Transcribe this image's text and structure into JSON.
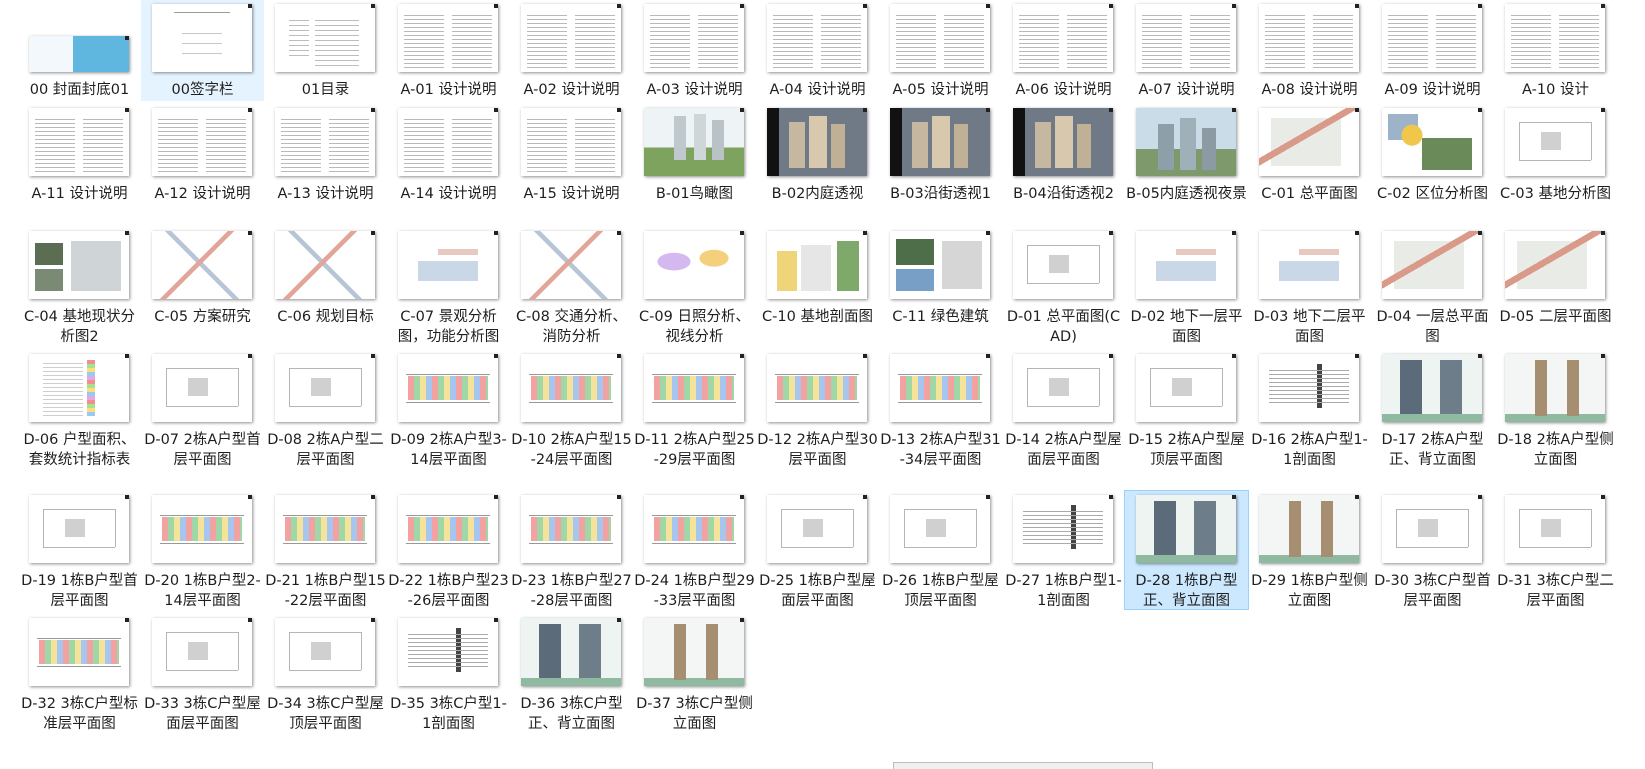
{
  "files": [
    {
      "label": "00  封面封底01",
      "thumb": "cover"
    },
    {
      "label": "00签字栏",
      "thumb": "sign",
      "state": "highlight"
    },
    {
      "label": "01目录",
      "thumb": "toc"
    },
    {
      "label": "A-01 设计说明",
      "thumb": "text"
    },
    {
      "label": "A-02 设计说明",
      "thumb": "text"
    },
    {
      "label": "A-03 设计说明",
      "thumb": "text"
    },
    {
      "label": "A-04 设计说明",
      "thumb": "text"
    },
    {
      "label": "A-05 设计说明",
      "thumb": "text"
    },
    {
      "label": "A-06 设计说明",
      "thumb": "text"
    },
    {
      "label": "A-07 设计说明",
      "thumb": "text"
    },
    {
      "label": "A-08 设计说明",
      "thumb": "text"
    },
    {
      "label": "A-09 设计说明",
      "thumb": "text"
    },
    {
      "label": "A-10 设计",
      "thumb": "text"
    },
    {
      "label": "A-11 设计说明",
      "thumb": "text"
    },
    {
      "label": "A-12 设计说明",
      "thumb": "text"
    },
    {
      "label": "A-13 设计说明",
      "thumb": "text"
    },
    {
      "label": "A-14 设计说明",
      "thumb": "text"
    },
    {
      "label": "A-15 设计说明",
      "thumb": "text"
    },
    {
      "label": "B-01鸟瞰图",
      "thumb": "aerial"
    },
    {
      "label": "B-02内庭透视",
      "thumb": "night"
    },
    {
      "label": "B-03沿街透视1",
      "thumb": "night"
    },
    {
      "label": "B-04沿街透视2",
      "thumb": "night"
    },
    {
      "label": "B-05内庭透视夜景",
      "thumb": "render"
    },
    {
      "label": "C-01 总平面图",
      "thumb": "site"
    },
    {
      "label": "C-02 区位分析图",
      "thumb": "map"
    },
    {
      "label": "C-03 基地分析图",
      "thumb": "cad"
    },
    {
      "label": "C-04 基地现状分析图2",
      "thumb": "photo"
    },
    {
      "label": "C-05 方案研究",
      "thumb": "diagram"
    },
    {
      "label": "C-06 规划目标",
      "thumb": "diagram"
    },
    {
      "label": "C-07 景观分析图，功能分析图",
      "thumb": "siteplan"
    },
    {
      "label": "C-08 交通分析、消防分析",
      "thumb": "diagram"
    },
    {
      "label": "C-09 日照分析、视线分析",
      "thumb": "sun"
    },
    {
      "label": "C-10  基地剖面图",
      "thumb": "secgraph"
    },
    {
      "label": "C-11 绿色建筑",
      "thumb": "green"
    },
    {
      "label": "D-01 总平面图(CAD)",
      "thumb": "cad"
    },
    {
      "label": "D-02  地下一层平面图",
      "thumb": "siteplan"
    },
    {
      "label": "D-03  地下二层平面图",
      "thumb": "siteplan"
    },
    {
      "label": "D-04 一层总平面图",
      "thumb": "site"
    },
    {
      "label": "D-05 二层平面图",
      "thumb": "site"
    },
    {
      "label": "D-06 户型面积、套数统计指标表",
      "thumb": "table"
    },
    {
      "label": "D-07 2栋A户型首层平面图",
      "thumb": "cad"
    },
    {
      "label": "D-08 2栋A户型二层平面图",
      "thumb": "cad"
    },
    {
      "label": "D-09 2栋A户型3-14层平面图",
      "thumb": "plan"
    },
    {
      "label": "D-10 2栋A户型15-24层平面图",
      "thumb": "plan"
    },
    {
      "label": "D-11 2栋A户型25-29层平面图",
      "thumb": "plan"
    },
    {
      "label": "D-12 2栋A户型30层平面图",
      "thumb": "plan"
    },
    {
      "label": "D-13 2栋A户型31-34层平面图",
      "thumb": "plan"
    },
    {
      "label": "D-14 2栋A户型屋面层平面图",
      "thumb": "cad"
    },
    {
      "label": "D-15 2栋A户型屋顶层平面图",
      "thumb": "cad"
    },
    {
      "label": "D-16 2栋A户型1-1剖面图",
      "thumb": "section"
    },
    {
      "label": "D-17 2栋A户型正、背立面图",
      "thumb": "elev"
    },
    {
      "label": "D-18 2栋A户型侧立面图",
      "thumb": "side"
    },
    {
      "label": "D-19 1栋B户型首层平面图",
      "thumb": "cad"
    },
    {
      "label": "D-20 1栋B户型2-14层平面图",
      "thumb": "plan"
    },
    {
      "label": "D-21 1栋B户型15-22层平面图",
      "thumb": "plan"
    },
    {
      "label": "D-22 1栋B户型23-26层平面图",
      "thumb": "plan"
    },
    {
      "label": "D-23 1栋B户型27-28层平面图",
      "thumb": "plan"
    },
    {
      "label": "D-24 1栋B户型29-33层平面图",
      "thumb": "plan"
    },
    {
      "label": "D-25 1栋B户型屋面层平面图",
      "thumb": "cad"
    },
    {
      "label": "D-26 1栋B户型屋顶层平面图",
      "thumb": "cad"
    },
    {
      "label": "D-27 1栋B户型1-1剖面图",
      "thumb": "section"
    },
    {
      "label": "D-28 1栋B户型正、背立面图",
      "thumb": "elev",
      "state": "selected"
    },
    {
      "label": "D-29 1栋B户型侧立面图",
      "thumb": "side"
    },
    {
      "label": "D-30 3栋C户型首层平面图",
      "thumb": "cad"
    },
    {
      "label": "D-31 3栋C户型二层平面图",
      "thumb": "cad"
    },
    {
      "label": "D-32 3栋C户型标准层平面图",
      "thumb": "plan"
    },
    {
      "label": "D-33 3栋C户型屋面层平面图",
      "thumb": "cad"
    },
    {
      "label": "D-34 3栋C户型屋顶层平面图",
      "thumb": "cad"
    },
    {
      "label": "D-35 3栋C户型1-1剖面图",
      "thumb": "section"
    },
    {
      "label": "D-36 3栋C户型正、背立面图",
      "thumb": "elev"
    },
    {
      "label": "D-37 3栋C户型侧立面图",
      "thumb": "side"
    }
  ]
}
